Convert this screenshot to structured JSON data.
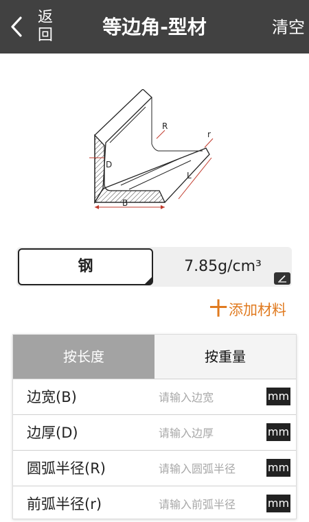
{
  "header": {
    "back_label": "返回",
    "title": "等边角-型材",
    "clear_label": "清空"
  },
  "diagram": {
    "labels": {
      "R": "R",
      "r": "r",
      "D": "D",
      "L": "L",
      "B": "B"
    }
  },
  "material": {
    "name": "钢",
    "density": "7.85g/cm³",
    "add_label": "添加材料",
    "add_symbol": "十"
  },
  "tabs": [
    {
      "label": "按长度",
      "active": true
    },
    {
      "label": "按重量",
      "active": false
    }
  ],
  "inputs": [
    {
      "label": "边宽(B)",
      "placeholder": "请输入边宽",
      "unit": "mm"
    },
    {
      "label": "边厚(D)",
      "placeholder": "请输入边厚",
      "unit": "mm"
    },
    {
      "label": "圆弧半径(R)",
      "placeholder": "请输入圆弧半径",
      "unit": "mm"
    },
    {
      "label": "前弧半径(r)",
      "placeholder": "请输入前弧半径",
      "unit": "mm"
    }
  ],
  "colors": {
    "header_bg": "#414141",
    "accent": "#e07a1f",
    "active_tab_bg": "#a3a3a3"
  }
}
